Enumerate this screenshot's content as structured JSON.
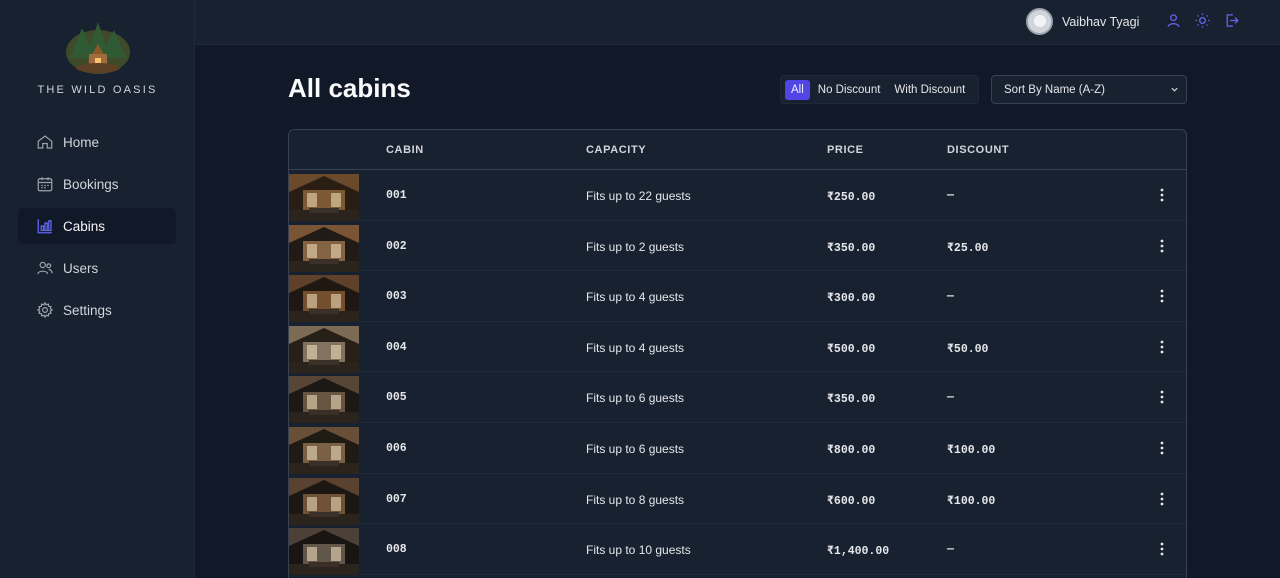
{
  "brand": {
    "name": "THE WILD OASIS"
  },
  "nav": {
    "items": [
      {
        "label": "Home",
        "icon": "home-icon",
        "active": false
      },
      {
        "label": "Bookings",
        "icon": "calendar-icon",
        "active": false
      },
      {
        "label": "Cabins",
        "icon": "chart-icon",
        "active": true
      },
      {
        "label": "Users",
        "icon": "users-icon",
        "active": false
      },
      {
        "label": "Settings",
        "icon": "gear-icon",
        "active": false
      }
    ]
  },
  "header": {
    "user_name": "Vaibhav Tyagi",
    "icons": [
      "user-icon",
      "sun-icon",
      "logout-icon"
    ]
  },
  "page": {
    "title": "All cabins",
    "filters": [
      "All",
      "No Discount",
      "With Discount"
    ],
    "active_filter": "All",
    "sort_value": "Sort By Name (A-Z)"
  },
  "table": {
    "headers": {
      "cabin": "CABIN",
      "capacity": "CAPACITY",
      "price": "PRICE",
      "discount": "DISCOUNT"
    },
    "rows": [
      {
        "cabin": "001",
        "capacity": "Fits up to 22 guests",
        "price": "₹250.00",
        "discount": "—"
      },
      {
        "cabin": "002",
        "capacity": "Fits up to 2 guests",
        "price": "₹350.00",
        "discount": "₹25.00"
      },
      {
        "cabin": "003",
        "capacity": "Fits up to 4 guests",
        "price": "₹300.00",
        "discount": "—"
      },
      {
        "cabin": "004",
        "capacity": "Fits up to 4 guests",
        "price": "₹500.00",
        "discount": "₹50.00"
      },
      {
        "cabin": "005",
        "capacity": "Fits up to 6 guests",
        "price": "₹350.00",
        "discount": "—"
      },
      {
        "cabin": "006",
        "capacity": "Fits up to 6 guests",
        "price": "₹800.00",
        "discount": "₹100.00"
      },
      {
        "cabin": "007",
        "capacity": "Fits up to 8 guests",
        "price": "₹600.00",
        "discount": "₹100.00"
      },
      {
        "cabin": "008",
        "capacity": "Fits up to 10 guests",
        "price": "₹1,400.00",
        "discount": "—"
      }
    ]
  },
  "colors": {
    "accent": "#4f46e5",
    "background": "#111827",
    "panel": "#18212f"
  }
}
